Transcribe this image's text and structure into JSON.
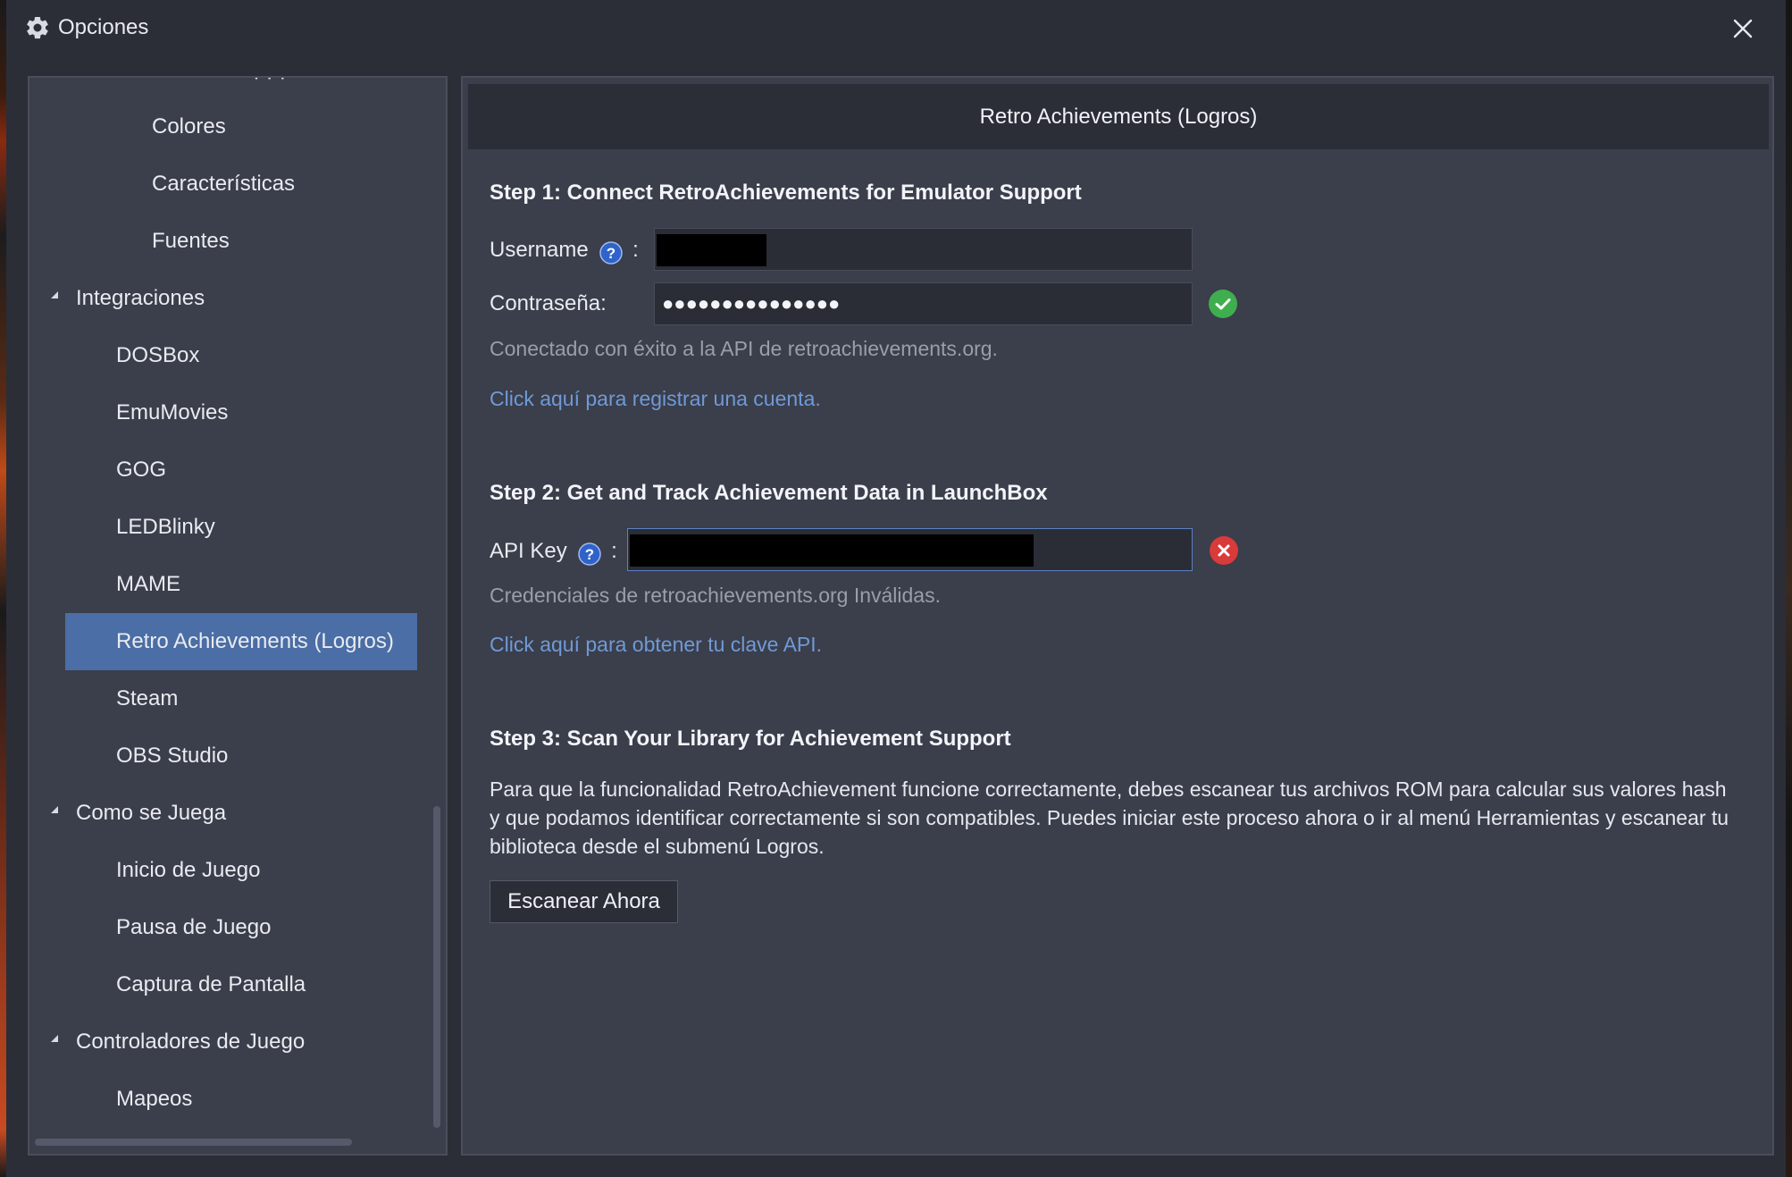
{
  "window": {
    "title": "Opciones",
    "title_icon": "gear-icon",
    "close_icon": "close-icon"
  },
  "tree": {
    "cut_text": "· · ·",
    "items": [
      {
        "label": "Colores",
        "level": 3
      },
      {
        "label": "Características",
        "level": 3
      },
      {
        "label": "Fuentes",
        "level": 3
      },
      {
        "label": "Integraciones",
        "level": 1,
        "expanded": true
      },
      {
        "label": "DOSBox",
        "level": 2
      },
      {
        "label": "EmuMovies",
        "level": 2
      },
      {
        "label": "GOG",
        "level": 2
      },
      {
        "label": "LEDBlinky",
        "level": 2
      },
      {
        "label": "MAME",
        "level": 2
      },
      {
        "label": "Retro Achievements (Logros)",
        "level": 2,
        "selected": true
      },
      {
        "label": "Steam",
        "level": 2
      },
      {
        "label": "OBS Studio",
        "level": 2
      },
      {
        "label": "Como se Juega",
        "level": 1,
        "expanded": true
      },
      {
        "label": "Inicio de Juego",
        "level": 2
      },
      {
        "label": "Pausa de Juego",
        "level": 2
      },
      {
        "label": "Captura de Pantalla",
        "level": 2
      },
      {
        "label": "Controladores de Juego",
        "level": 1,
        "expanded": true
      },
      {
        "label": "Mapeos",
        "level": 2
      }
    ]
  },
  "content": {
    "header": "Retro Achievements (Logros)",
    "step1": {
      "title": "Step 1: Connect RetroAchievements for Emulator Support",
      "username_label": "Username",
      "password_label": "Contraseña:",
      "password_value": "●●●●●●●●●●●●●●●",
      "status_text": "Conectado con éxito a la API de retroachievements.org.",
      "register_link": "Click aquí para registrar una cuenta."
    },
    "step2": {
      "title": "Step 2: Get and Track Achievement Data in LaunchBox",
      "apikey_label": "API Key",
      "status_text": "Credenciales de retroachievements.org Inválidas.",
      "apikey_link": "Click aquí para obtener tu clave API."
    },
    "step3": {
      "title": "Step 3: Scan Your Library for Achievement Support",
      "description": "Para que la funcionalidad RetroAchievement funcione correctamente, debes escanear tus archivos ROM para calcular sus valores hash y que podamos identificar correctamente si son compatibles. Puedes iniciar este proceso ahora o ir al menú Herramientas y escanear tu biblioteca desde el submenú Logros.",
      "scan_button": "Escanear Ahora"
    },
    "colon": ":",
    "colors": {
      "success": "#3fae4e",
      "error": "#d93a3a",
      "link": "#6f9ad6",
      "selected": "#4a6ea5"
    }
  }
}
